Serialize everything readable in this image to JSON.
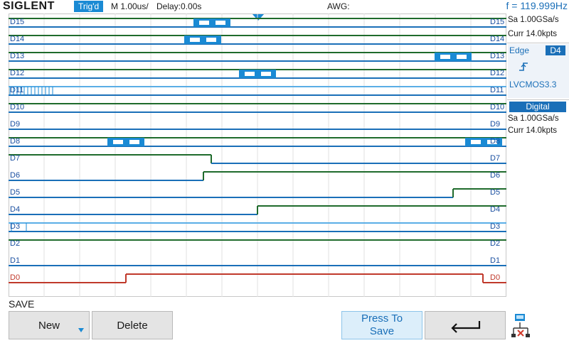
{
  "topbar": {
    "brand": "SIGLENT",
    "trig_status": "Trig'd",
    "timebase": "M 1.00us/",
    "delay": "Delay:0.00s",
    "awg": "AWG:",
    "frequency": "f = 119.999Hz"
  },
  "channels": [
    "D15",
    "D14",
    "D13",
    "D12",
    "D11",
    "D10",
    "D9",
    "D8",
    "D7",
    "D6",
    "D5",
    "D4",
    "D3",
    "D2",
    "D1",
    "D0"
  ],
  "right_panel": {
    "acq1_rate": "Sa 1.00GSa/s",
    "acq1_depth": "Curr 14.0kpts",
    "trigger_type": "Edge",
    "trigger_source": "D4",
    "trigger_slope_icon": "rising-edge-icon",
    "trigger_level": "LVCMOS3.3",
    "digital_label": "Digital",
    "acq2_rate": "Sa 1.00GSa/s",
    "acq2_depth": "Curr 14.0kpts"
  },
  "menu": {
    "title": "SAVE",
    "new_label": "New",
    "delete_label": "Delete",
    "press_to_save_line1": "Press To",
    "press_to_save_line2": "Save",
    "back_icon": "return-arrow-icon",
    "network_icon": "network-icon"
  },
  "colors": {
    "accent": "#1a8ad4",
    "channel_blue": "#1a6fb8",
    "channel_green": "#1f6b2c",
    "channel_red": "#c0392b"
  }
}
